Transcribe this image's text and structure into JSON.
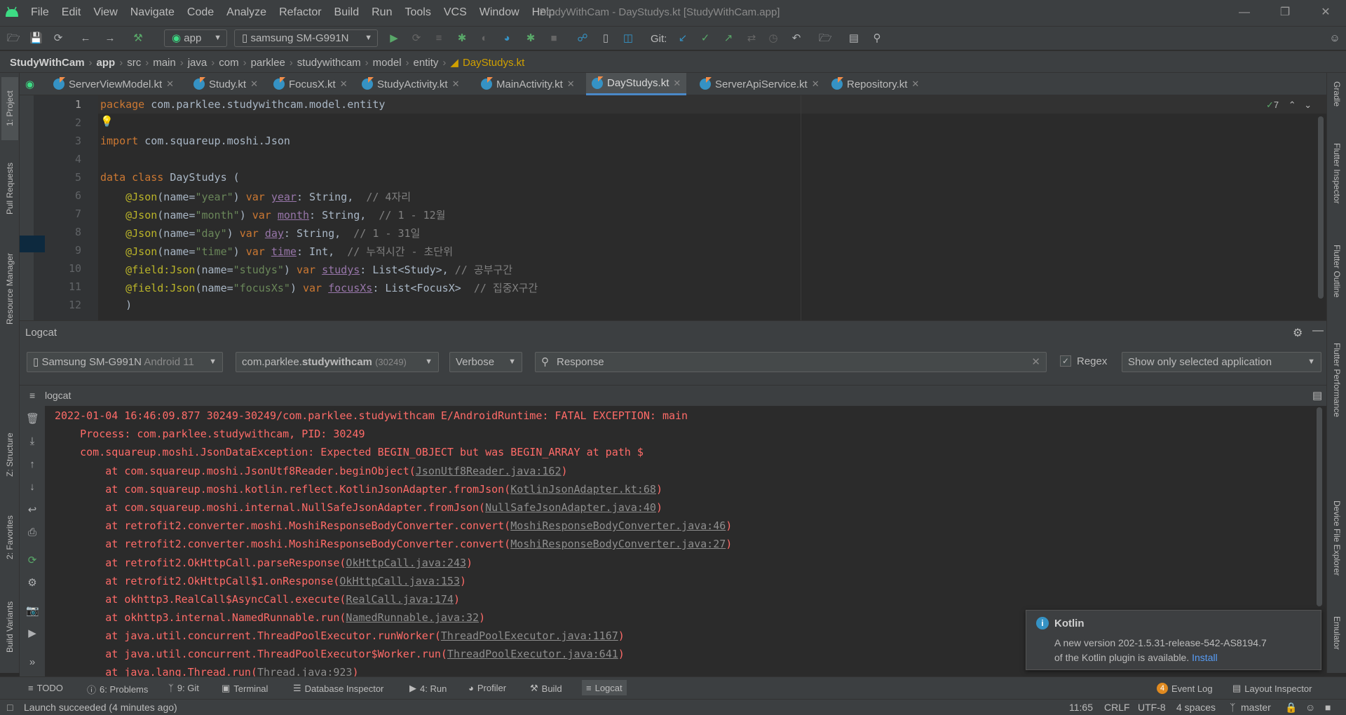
{
  "window": {
    "title": "StudyWithCam - DayStudys.kt [StudyWithCam.app]",
    "menus": [
      "File",
      "Edit",
      "View",
      "Navigate",
      "Code",
      "Analyze",
      "Refactor",
      "Build",
      "Run",
      "Tools",
      "VCS",
      "Window",
      "Help"
    ]
  },
  "toolbar": {
    "run_config": "app",
    "device": "samsung SM-G991N",
    "git_label": "Git:"
  },
  "breadcrumb": [
    "StudyWithCam",
    "app",
    "src",
    "main",
    "java",
    "com",
    "parklee",
    "studywithcam",
    "model",
    "entity",
    "DayStudys.kt"
  ],
  "left_tabs": {
    "project": "1: Project",
    "pull_requests": "Pull Requests",
    "resource_manager": "Resource Manager",
    "structure": "Z: Structure",
    "favorites": "2: Favorites",
    "build_variants": "Build Variants"
  },
  "right_tabs": {
    "gradle": "Gradle",
    "flutter_inspector": "Flutter Inspector",
    "flutter_outline": "Flutter Outline",
    "flutter_performance": "Flutter Performance",
    "device_file_explorer": "Device File Explorer",
    "emulator": "Emulator"
  },
  "editor_tabs": [
    {
      "label": "ServerViewModel.kt",
      "active": false
    },
    {
      "label": "Study.kt",
      "active": false
    },
    {
      "label": "FocusX.kt",
      "active": false
    },
    {
      "label": "StudyActivity.kt",
      "active": false
    },
    {
      "label": "MainActivity.kt",
      "active": false
    },
    {
      "label": "DayStudys.kt",
      "active": true
    },
    {
      "label": "ServerApiService.kt",
      "active": false
    },
    {
      "label": "Repository.kt",
      "active": false
    }
  ],
  "editor": {
    "warning_count": "7",
    "line_numbers": [
      "1",
      "2",
      "3",
      "4",
      "5",
      "6",
      "7",
      "8",
      "9",
      "10",
      "11",
      "12"
    ],
    "code": {
      "l1_kw": "package",
      "l1_rest": " com.parklee.studywithcam.model.entity",
      "l3_kw": "import",
      "l3_rest": " com.squareup.moshi.Json",
      "l5_kw": "data class",
      "l5_rest": " DayStudys (",
      "l6_ann": "@Json",
      "l6_a": "(name=",
      "l6_str": "\"year\"",
      "l6_b": ") ",
      "l6_kw": "var",
      "l6_prop": "year",
      "l6_c": ": String,  ",
      "l6_cmt": "// 4자리",
      "l7_ann": "@Json",
      "l7_a": "(name=",
      "l7_str": "\"month\"",
      "l7_b": ") ",
      "l7_kw": "var",
      "l7_prop": "month",
      "l7_c": ": String,  ",
      "l7_cmt": "// 1 - 12월",
      "l8_ann": "@Json",
      "l8_a": "(name=",
      "l8_str": "\"day\"",
      "l8_b": ") ",
      "l8_kw": "var",
      "l8_prop": "day",
      "l8_c": ": String,  ",
      "l8_cmt": "// 1 - 31일",
      "l9_ann": "@Json",
      "l9_a": "(name=",
      "l9_str": "\"time\"",
      "l9_b": ") ",
      "l9_kw": "var",
      "l9_prop": "time",
      "l9_c": ": Int,  ",
      "l9_cmt": "// 누적시간 - 초단위",
      "l10_ann": "@field:Json",
      "l10_a": "(name=",
      "l10_str": "\"studys\"",
      "l10_b": ") ",
      "l10_kw": "var",
      "l10_prop": "studys",
      "l10_c": ": List<Study>, ",
      "l10_cmt": "// 공부구간",
      "l11_ann": "@field:Json",
      "l11_a": "(name=",
      "l11_str": "\"focusXs\"",
      "l11_b": ") ",
      "l11_kw": "var",
      "l11_prop": "focusXs",
      "l11_c": ": List<FocusX>  ",
      "l11_cmt": "// 집중X구간",
      "l12": ")"
    }
  },
  "logcat": {
    "title": "Logcat",
    "device_name": "Samsung SM-G991N",
    "device_os": "Android 11",
    "process_prefix": "com.parklee.",
    "process_bold": "studywithcam",
    "process_pid": "(30249)",
    "level": "Verbose",
    "search_value": "Response",
    "regex_label": "Regex",
    "filter": "Show only selected application",
    "sub_tab": "logcat",
    "lines": [
      {
        "text": "2022-01-04 16:46:09.877 30249-30249/com.parklee.studywithcam E/AndroidRuntime: FATAL EXCEPTION: main",
        "link": "",
        "tail": ""
      },
      {
        "text": "    Process: com.parklee.studywithcam, PID: 30249",
        "link": "",
        "tail": ""
      },
      {
        "text": "    com.squareup.moshi.JsonDataException: Expected BEGIN_OBJECT but was BEGIN_ARRAY at path $",
        "link": "",
        "tail": ""
      },
      {
        "text": "        at com.squareup.moshi.JsonUtf8Reader.beginObject(",
        "link": "JsonUtf8Reader.java:162",
        "tail": ")"
      },
      {
        "text": "        at com.squareup.moshi.kotlin.reflect.KotlinJsonAdapter.fromJson(",
        "link": "KotlinJsonAdapter.kt:68",
        "tail": ")"
      },
      {
        "text": "        at com.squareup.moshi.internal.NullSafeJsonAdapter.fromJson(",
        "link": "NullSafeJsonAdapter.java:40",
        "tail": ")"
      },
      {
        "text": "        at retrofit2.converter.moshi.MoshiResponseBodyConverter.convert(",
        "link": "MoshiResponseBodyConverter.java:46",
        "tail": ")"
      },
      {
        "text": "        at retrofit2.converter.moshi.MoshiResponseBodyConverter.convert(",
        "link": "MoshiResponseBodyConverter.java:27",
        "tail": ")"
      },
      {
        "text": "        at retrofit2.OkHttpCall.parseResponse(",
        "link": "OkHttpCall.java:243",
        "tail": ")"
      },
      {
        "text": "        at retrofit2.OkHttpCall$1.onResponse(",
        "link": "OkHttpCall.java:153",
        "tail": ")"
      },
      {
        "text": "        at okhttp3.RealCall$AsyncCall.execute(",
        "link": "RealCall.java:174",
        "tail": ")"
      },
      {
        "text": "        at okhttp3.internal.NamedRunnable.run(",
        "link": "NamedRunnable.java:32",
        "tail": ")"
      },
      {
        "text": "        at java.util.concurrent.ThreadPoolExecutor.runWorker(",
        "link": "ThreadPoolExecutor.java:1167",
        "tail": ")"
      },
      {
        "text": "        at java.util.concurrent.ThreadPoolExecutor$Worker.run(",
        "link": "ThreadPoolExecutor.java:641",
        "tail": ")"
      },
      {
        "text": "        at java.lang.Thread.run(",
        "link": "Thread.java:923",
        "tail": ")"
      }
    ]
  },
  "notification": {
    "title": "Kotlin",
    "line1": "A new version 202-1.5.31-release-542-AS8194.7",
    "line2": "of the Kotlin plugin is available. ",
    "action": "Install"
  },
  "bottom_tabs": {
    "todo": "TODO",
    "problems": "6: Problems",
    "git": "9: Git",
    "terminal": "Terminal",
    "database_inspector": "Database Inspector",
    "run": "4: Run",
    "profiler": "Profiler",
    "build": "Build",
    "logcat": "Logcat",
    "event_log": "Event Log",
    "event_log_count": "4",
    "layout_inspector": "Layout Inspector"
  },
  "status": {
    "message": "Launch succeeded (4 minutes ago)",
    "position": "11:65",
    "line_sep": "CRLF",
    "encoding": "UTF-8",
    "indent": "4 spaces",
    "branch": "master"
  },
  "colors": {
    "error_text": "#ff6b68",
    "accent": "#4a88c7",
    "keyword": "#cc7832",
    "string": "#6a8759",
    "annotation": "#bbb529"
  }
}
